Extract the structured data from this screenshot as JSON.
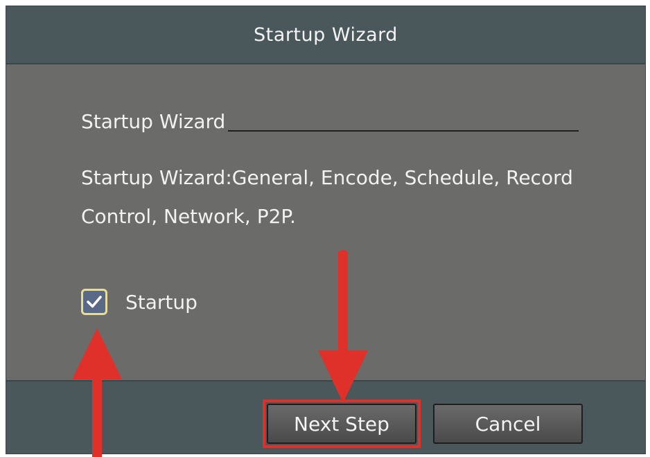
{
  "dialog": {
    "title": "Startup Wizard"
  },
  "content": {
    "section_title": "Startup Wizard",
    "description": "Startup Wizard:General, Encode, Schedule, Record Control, Network, P2P.",
    "startup_checkbox": {
      "label": "Startup",
      "checked": true
    }
  },
  "footer": {
    "next_label": "Next Step",
    "cancel_label": "Cancel"
  },
  "annotations": {
    "arrow_color": "#e0302a"
  }
}
